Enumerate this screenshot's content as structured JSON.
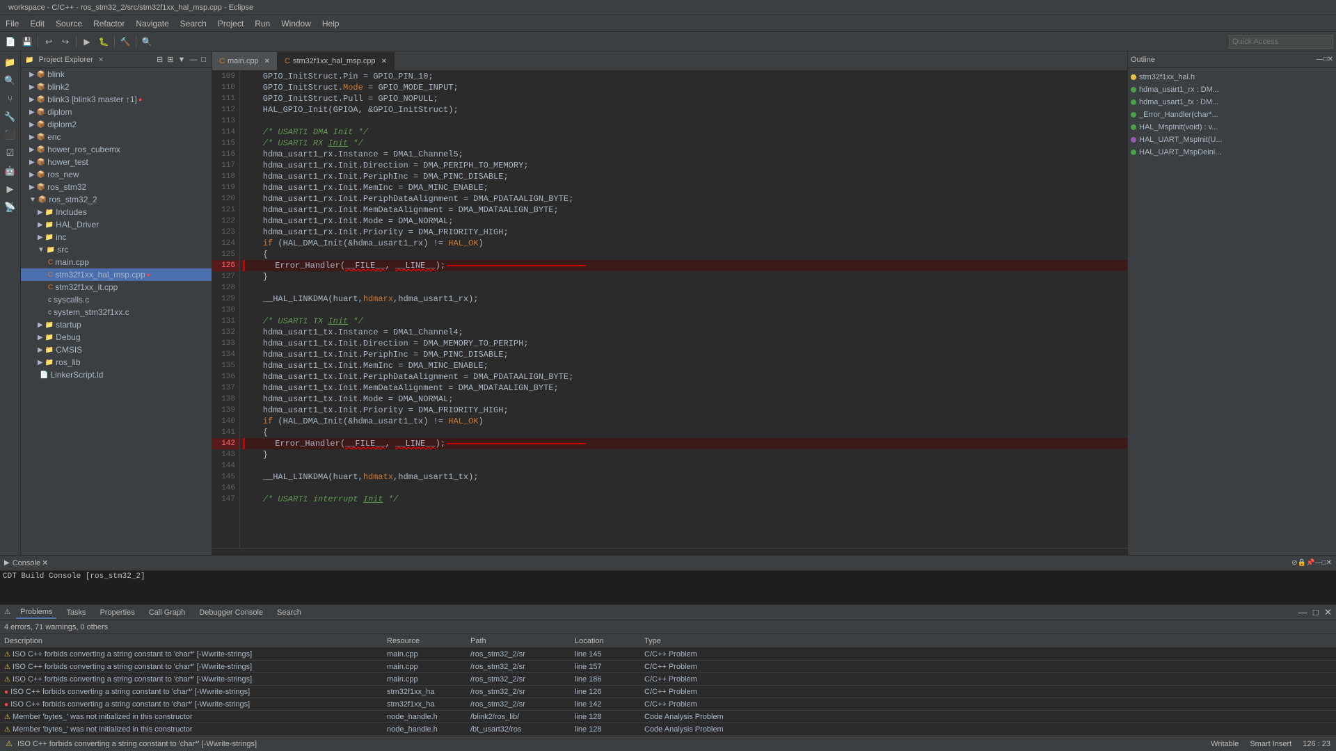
{
  "titlebar": {
    "text": "workspace - C/C++ - ros_stm32_2/src/stm32f1xx_hal_msp.cpp - Eclipse"
  },
  "menubar": {
    "items": [
      "File",
      "Edit",
      "Source",
      "Refactor",
      "Navigate",
      "Search",
      "Project",
      "Run",
      "Window",
      "Help"
    ]
  },
  "toolbar": {
    "quick_access_placeholder": "Quick Access"
  },
  "project_explorer": {
    "title": "Project Explorer",
    "items": [
      {
        "label": "blink",
        "indent": 1,
        "type": "project"
      },
      {
        "label": "blink2",
        "indent": 1,
        "type": "project"
      },
      {
        "label": "blink3 [blink3 master ↑1]",
        "indent": 1,
        "type": "project",
        "error": true
      },
      {
        "label": "diplom",
        "indent": 1,
        "type": "project"
      },
      {
        "label": "diplom2",
        "indent": 1,
        "type": "project"
      },
      {
        "label": "enc",
        "indent": 1,
        "type": "project"
      },
      {
        "label": "hower_ros_cubemx",
        "indent": 1,
        "type": "project"
      },
      {
        "label": "hower_test",
        "indent": 1,
        "type": "project"
      },
      {
        "label": "ros_new",
        "indent": 1,
        "type": "project"
      },
      {
        "label": "ros_stm32",
        "indent": 1,
        "type": "project"
      },
      {
        "label": "ros_stm32_2",
        "indent": 1,
        "type": "project",
        "expanded": true
      },
      {
        "label": "Includes",
        "indent": 2,
        "type": "folder"
      },
      {
        "label": "HAL_Driver",
        "indent": 2,
        "type": "folder"
      },
      {
        "label": "inc",
        "indent": 2,
        "type": "folder"
      },
      {
        "label": "src",
        "indent": 2,
        "type": "folder",
        "expanded": true
      },
      {
        "label": "main.cpp",
        "indent": 3,
        "type": "cpp"
      },
      {
        "label": "stm32f1xx_hal_msp.cpp",
        "indent": 3,
        "type": "cpp",
        "selected": true,
        "error": true
      },
      {
        "label": "stm32f1xx_it.cpp",
        "indent": 3,
        "type": "cpp"
      },
      {
        "label": "syscalls.c",
        "indent": 3,
        "type": "c"
      },
      {
        "label": "system_stm32f1xx.c",
        "indent": 3,
        "type": "c"
      },
      {
        "label": "startup",
        "indent": 2,
        "type": "folder"
      },
      {
        "label": "Debug",
        "indent": 2,
        "type": "folder"
      },
      {
        "label": "CMSIS",
        "indent": 2,
        "type": "folder"
      },
      {
        "label": "ros_lib",
        "indent": 2,
        "type": "folder"
      },
      {
        "label": "LinkerScript.ld",
        "indent": 2,
        "type": "file"
      }
    ]
  },
  "tabs": [
    {
      "label": "main.cpp",
      "active": false
    },
    {
      "label": "stm32f1xx_hal_msp.cpp",
      "active": true
    }
  ],
  "code": {
    "lines": [
      {
        "num": 109,
        "text": "    GPIO_InitStruct.Pin = GPIO_PIN_10;",
        "error": false
      },
      {
        "num": 110,
        "text": "    GPIO_InitStruct.Mode = GPIO_MODE_INPUT;",
        "error": false
      },
      {
        "num": 111,
        "text": "    GPIO_InitStruct.Pull = GPIO_NOPULL;",
        "error": false
      },
      {
        "num": 112,
        "text": "    HAL_GPIO_Init(GPIOA, &GPIO_InitStruct);",
        "error": false
      },
      {
        "num": 113,
        "text": "",
        "error": false
      },
      {
        "num": 114,
        "text": "    /* USART1 DMA Init */",
        "error": false
      },
      {
        "num": 115,
        "text": "    /* USART1 RX Init */",
        "error": false
      },
      {
        "num": 116,
        "text": "    hdma_usart1_rx.Instance = DMA1_Channel5;",
        "error": false
      },
      {
        "num": 117,
        "text": "    hdma_usart1_rx.Init.Direction = DMA_PERIPH_TO_MEMORY;",
        "error": false
      },
      {
        "num": 118,
        "text": "    hdma_usart1_rx.Init.PeriphInc = DMA_PINC_DISABLE;",
        "error": false
      },
      {
        "num": 119,
        "text": "    hdma_usart1_rx.Init.MemInc = DMA_MINC_ENABLE;",
        "error": false
      },
      {
        "num": 120,
        "text": "    hdma_usart1_rx.Init.PeriphDataAlignment = DMA_PDATAALIGN_BYTE;",
        "error": false
      },
      {
        "num": 121,
        "text": "    hdma_usart1_rx.Init.MemDataAlignment = DMA_MDATAALIGN_BYTE;",
        "error": false
      },
      {
        "num": 122,
        "text": "    hdma_usart1_rx.Init.Mode = DMA_NORMAL;",
        "error": false
      },
      {
        "num": 123,
        "text": "    hdma_usart1_rx.Init.Priority = DMA_PRIORITY_HIGH;",
        "error": false
      },
      {
        "num": 124,
        "text": "    if (HAL_DMA_Init(&hdma_usart1_rx) != HAL_OK)",
        "error": false
      },
      {
        "num": 125,
        "text": "    {",
        "error": false
      },
      {
        "num": 126,
        "text": "      Error_Handler(__FILE__, __LINE__);",
        "error": true
      },
      {
        "num": 127,
        "text": "    }",
        "error": false
      },
      {
        "num": 128,
        "text": "",
        "error": false
      },
      {
        "num": 129,
        "text": "    __HAL_LINKDMA(huart,hdmarx,hdma_usart1_rx);",
        "error": false
      },
      {
        "num": 130,
        "text": "",
        "error": false
      },
      {
        "num": 131,
        "text": "    /* USART1 TX Init */",
        "error": false
      },
      {
        "num": 132,
        "text": "    hdma_usart1_tx.Instance = DMA1_Channel4;",
        "error": false
      },
      {
        "num": 133,
        "text": "    hdma_usart1_tx.Init.Direction = DMA_MEMORY_TO_PERIPH;",
        "error": false
      },
      {
        "num": 134,
        "text": "    hdma_usart1_tx.Init.PeriphInc = DMA_PINC_DISABLE;",
        "error": false
      },
      {
        "num": 135,
        "text": "    hdma_usart1_tx.Init.MemInc = DMA_MINC_ENABLE;",
        "error": false
      },
      {
        "num": 136,
        "text": "    hdma_usart1_tx.Init.PeriphDataAlignment = DMA_PDATAALIGN_BYTE;",
        "error": false
      },
      {
        "num": 137,
        "text": "    hdma_usart1_tx.Init.MemDataAlignment = DMA_MDATAALIGN_BYTE;",
        "error": false
      },
      {
        "num": 138,
        "text": "    hdma_usart1_tx.Init.Mode = DMA_NORMAL;",
        "error": false
      },
      {
        "num": 139,
        "text": "    hdma_usart1_tx.Init.Priority = DMA_PRIORITY_HIGH;",
        "error": false
      },
      {
        "num": 140,
        "text": "    if (HAL_DMA_Init(&hdma_usart1_tx) != HAL_OK)",
        "error": false
      },
      {
        "num": 141,
        "text": "    {",
        "error": false
      },
      {
        "num": 142,
        "text": "      Error_Handler(__FILE__, __LINE__);",
        "error": true
      },
      {
        "num": 143,
        "text": "    }",
        "error": false
      },
      {
        "num": 144,
        "text": "",
        "error": false
      },
      {
        "num": 145,
        "text": "    __HAL_LINKDMA(huart,hdmatx,hdma_usart1_tx);",
        "error": false
      },
      {
        "num": 146,
        "text": "",
        "error": false
      },
      {
        "num": 147,
        "text": "    /* USART1 interrupt Init */",
        "error": false
      }
    ]
  },
  "right_panel": {
    "items": [
      {
        "label": "stm32f1xx_hal.h",
        "color": "yellow"
      },
      {
        "label": "hdma_usart1_rx : DM...",
        "color": "green"
      },
      {
        "label": "hdma_usart1_tx : DM...",
        "color": "green"
      },
      {
        "label": "_Error_Handler(char*...",
        "color": "green"
      },
      {
        "label": "HAL_MspInit(void) : v...",
        "color": "green"
      },
      {
        "label": "HAL_UART_MspInit(U...",
        "color": "purple"
      },
      {
        "label": "HAL_UART_MspDeini...",
        "color": "green"
      }
    ]
  },
  "console": {
    "title": "Console",
    "build_label": "CDT Build Console [ros_stm32_2]"
  },
  "problems": {
    "tabs": [
      "Problems",
      "Tasks",
      "Properties",
      "Call Graph",
      "Debugger Console",
      "Search"
    ],
    "summary": "4 errors, 71 warnings, 0 others",
    "columns": [
      "Description",
      "Resource",
      "Path",
      "Location",
      "Type"
    ],
    "col_widths": [
      "550",
      "120",
      "150",
      "100",
      "160"
    ],
    "rows": [
      {
        "icon": "warn",
        "desc": "ISO C++ forbids converting a string constant to 'char*' [-Wwrite-strings]",
        "resource": "main.cpp",
        "path": "/ros_stm32_2/sr",
        "location": "line 145",
        "type": "C/C++ Problem"
      },
      {
        "icon": "warn",
        "desc": "ISO C++ forbids converting a string constant to 'char*' [-Wwrite-strings]",
        "resource": "main.cpp",
        "path": "/ros_stm32_2/sr",
        "location": "line 157",
        "type": "C/C++ Problem"
      },
      {
        "icon": "warn",
        "desc": "ISO C++ forbids converting a string constant to 'char*' [-Wwrite-strings]",
        "resource": "main.cpp",
        "path": "/ros_stm32_2/sr",
        "location": "line 186",
        "type": "C/C++ Problem"
      },
      {
        "icon": "error",
        "desc": "ISO C++ forbids converting a string constant to 'char*' [-Wwrite-strings]",
        "resource": "stm32f1xx_ha",
        "path": "/ros_stm32_2/sr",
        "location": "line 126",
        "type": "C/C++ Problem"
      },
      {
        "icon": "error",
        "desc": "ISO C++ forbids converting a string constant to 'char*' [-Wwrite-strings]",
        "resource": "stm32f1xx_ha",
        "path": "/ros_stm32_2/sr",
        "location": "line 142",
        "type": "C/C++ Problem"
      },
      {
        "icon": "warn",
        "desc": "Member 'bytes_' was not initialized in this constructor",
        "resource": "node_handle.h",
        "path": "/blink2/ros_lib/",
        "location": "line 128",
        "type": "Code Analysis Problem"
      },
      {
        "icon": "warn",
        "desc": "Member 'bytes_' was not initialized in this constructor",
        "resource": "node_handle.h",
        "path": "/bt_usart32/ros",
        "location": "line 128",
        "type": "Code Analysis Problem"
      }
    ]
  },
  "statusbar": {
    "message": "ISO C++ forbids converting a string constant to 'char*' [-Wwrite-strings]",
    "writable": "Writable",
    "insert_mode": "Smart Insert",
    "position": "126 : 23"
  }
}
